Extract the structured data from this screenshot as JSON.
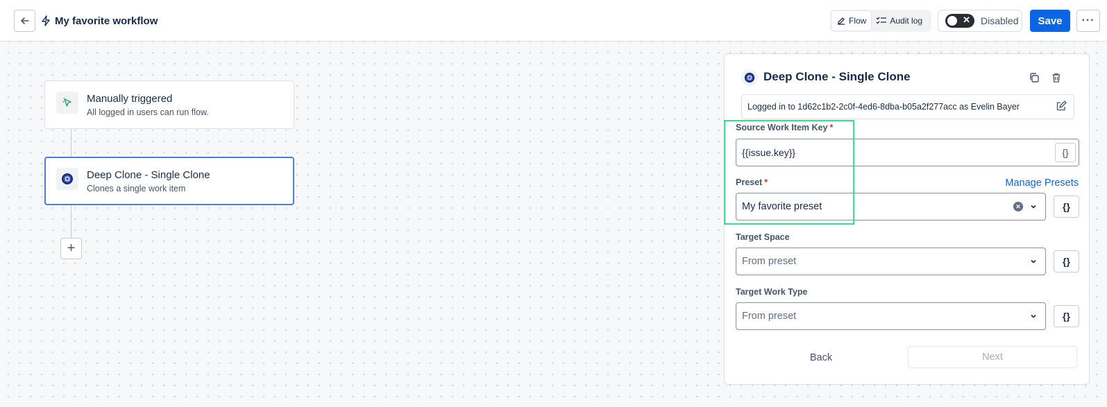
{
  "header": {
    "workflow_title": "My favorite workflow",
    "tabs": [
      {
        "label": "Flow",
        "icon": "edit-icon",
        "active": true
      },
      {
        "label": "Audit log",
        "icon": "checklist-icon",
        "active": false
      }
    ],
    "toggle_label": "Disabled",
    "toggle_state": "off",
    "save_label": "Save",
    "more_label": "···"
  },
  "canvas": {
    "nodes": [
      {
        "title": "Manually triggered",
        "subtitle": "All logged in users can run flow.",
        "icon": "cursor-click-icon",
        "selected": false
      },
      {
        "title": "Deep Clone - Single Clone",
        "subtitle": "Clones a single work item",
        "icon": "deep-clone-app-icon",
        "selected": true
      }
    ],
    "add_label": "+"
  },
  "panel": {
    "title": "Deep Clone - Single Clone",
    "login_text": "Logged in to 1d62c1b2-2c0f-4ed6-8dba-b05a2f277acc as Evelin Bayer",
    "fields": {
      "source_key": {
        "label": "Source Work Item Key",
        "value": "{{issue.key}}",
        "required": true
      },
      "preset": {
        "label": "Preset",
        "value": "My favorite preset",
        "required": true,
        "link": "Manage Presets"
      },
      "target_space": {
        "label": "Target Space",
        "value": "From preset"
      },
      "target_work_type": {
        "label": "Target Work Type",
        "value": "From preset"
      }
    },
    "braces": "{}",
    "back_label": "Back",
    "next_label": "Next"
  },
  "colors": {
    "accent": "#0c66e4",
    "highlight": "#2ee58e",
    "selected_border": "#4c7ed6",
    "required": "#c9372c"
  }
}
